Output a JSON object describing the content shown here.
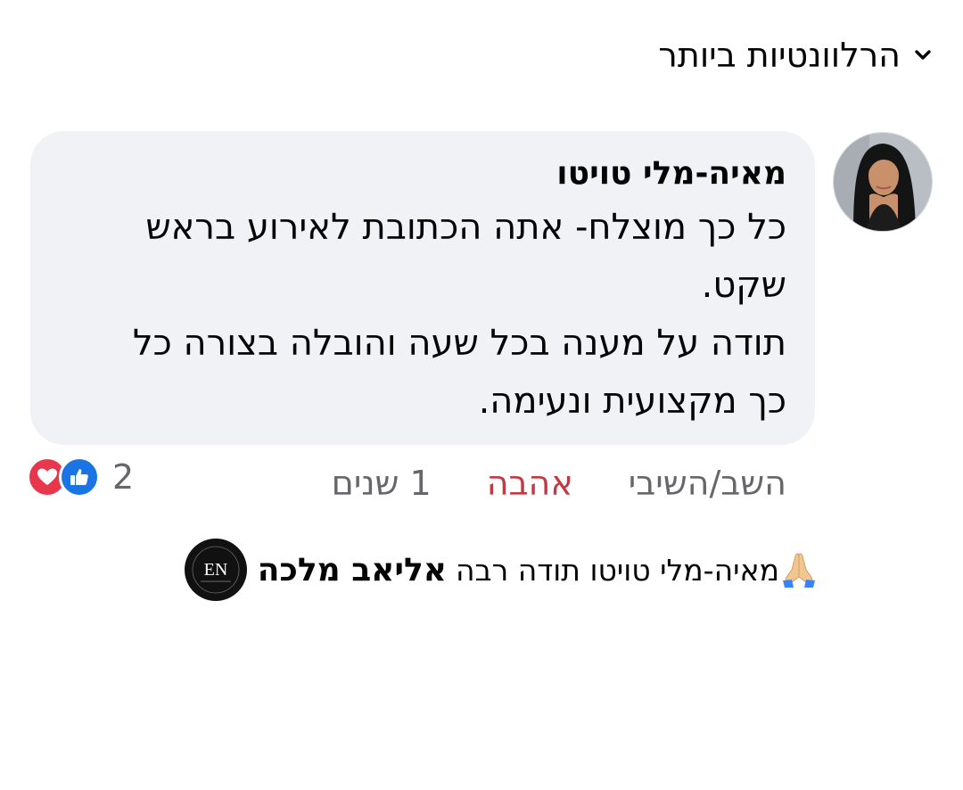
{
  "sort": {
    "label": "הרלוונטיות ביותר",
    "icon": "chevron-down-icon"
  },
  "comment": {
    "author": "מאיה-מלי טויטו",
    "lines": [
      "כל כך מוצלח- אתה הכתובת לאירוע בראש",
      "שקט.",
      "תודה על מענה בכל שעה והובלה בצורה כל",
      "כך מקצועית ונעימה."
    ],
    "time": "1 שנים",
    "like_label": "אהבה",
    "reply_label": "השב/השיבי",
    "reaction_count": "2",
    "reaction_icons": [
      "love-icon",
      "like-icon"
    ]
  },
  "reply": {
    "author": "אליאב מלכה",
    "text": "מאיה-מלי טויטו תודה רבה",
    "emoji_icon": "folded-hands-icon",
    "avatar_logo": "EN"
  },
  "colors": {
    "bubble": "#f0f2f5",
    "love_link": "#c03a45",
    "secondary_text": "#65676b",
    "like_blue": "#1b74e4",
    "love_red": "#e8364d"
  }
}
